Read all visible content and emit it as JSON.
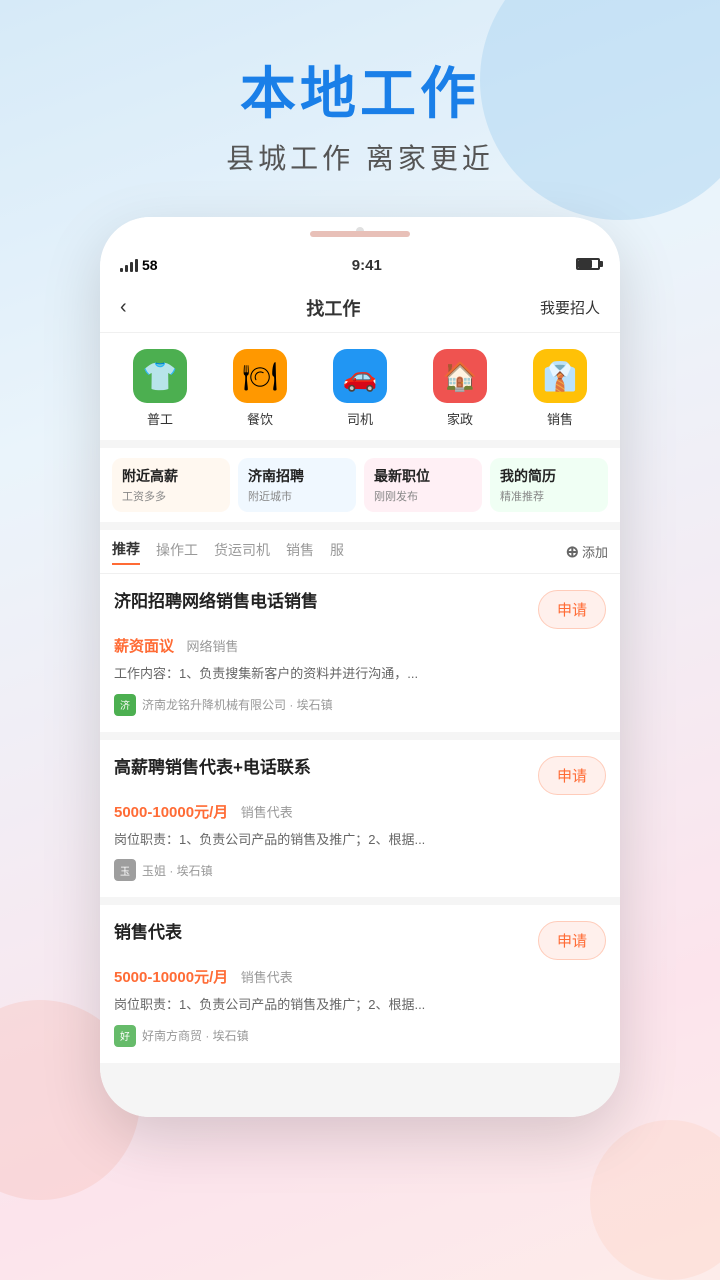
{
  "header": {
    "main_title": "本地工作",
    "sub_title": "县城工作  离家更近"
  },
  "status_bar": {
    "signal": "58",
    "time": "9:41",
    "battery": "70"
  },
  "nav": {
    "back_label": "‹",
    "title": "找工作",
    "action": "我要招人"
  },
  "categories": [
    {
      "id": "general",
      "label": "普工",
      "emoji": "👕",
      "color_class": "icon-green"
    },
    {
      "id": "food",
      "label": "餐饮",
      "emoji": "🍽",
      "color_class": "icon-orange"
    },
    {
      "id": "driver",
      "label": "司机",
      "emoji": "🚗",
      "color_class": "icon-blue"
    },
    {
      "id": "housekeeping",
      "label": "家政",
      "emoji": "🏠",
      "color_class": "icon-red"
    },
    {
      "id": "sales",
      "label": "销售",
      "emoji": "👔",
      "color_class": "icon-yellow"
    }
  ],
  "quick_cards": [
    {
      "id": "nearby_high",
      "title": "附近高薪",
      "sub": "工资多多"
    },
    {
      "id": "jinan",
      "title": "济南招聘",
      "sub": "附近城市"
    },
    {
      "id": "latest",
      "title": "最新职位",
      "sub": "刚刚发布"
    },
    {
      "id": "resume",
      "title": "我的简历",
      "sub": "精准推荐"
    }
  ],
  "tabs": [
    {
      "id": "recommend",
      "label": "推荐",
      "active": true
    },
    {
      "id": "operator",
      "label": "操作工",
      "active": false
    },
    {
      "id": "driver",
      "label": "货运司机",
      "active": false
    },
    {
      "id": "sales",
      "label": "销售",
      "active": false
    },
    {
      "id": "more",
      "label": "服",
      "active": false
    }
  ],
  "tab_add": "添加",
  "jobs": [
    {
      "id": "job1",
      "title": "济阳招聘网络销售电话销售",
      "salary": "薪资面议",
      "salary_tag": "网络销售",
      "desc": "工作内容：1、负责搜集新客户的资料并进行沟通，...",
      "company": "济南龙铭升降机械有限公司 · 埃石镇",
      "company_color": "#4CAF50",
      "apply_label": "申请"
    },
    {
      "id": "job2",
      "title": "高薪聘销售代表+电话联系",
      "salary": "5000-10000元/月",
      "salary_tag": "销售代表",
      "desc": "岗位职责：1、负责公司产品的销售及推广；2、根据...",
      "company": "玉姐 · 埃石镇",
      "company_color": "#9E9E9E",
      "apply_label": "申请"
    },
    {
      "id": "job3",
      "title": "销售代表",
      "salary": "5000-10000元/月",
      "salary_tag": "销售代表",
      "desc": "岗位职责：1、负责公司产品的销售及推广；2、根据...",
      "company": "好南方商贸 · 埃石镇",
      "company_color": "#66BB6A",
      "apply_label": "申请"
    }
  ]
}
